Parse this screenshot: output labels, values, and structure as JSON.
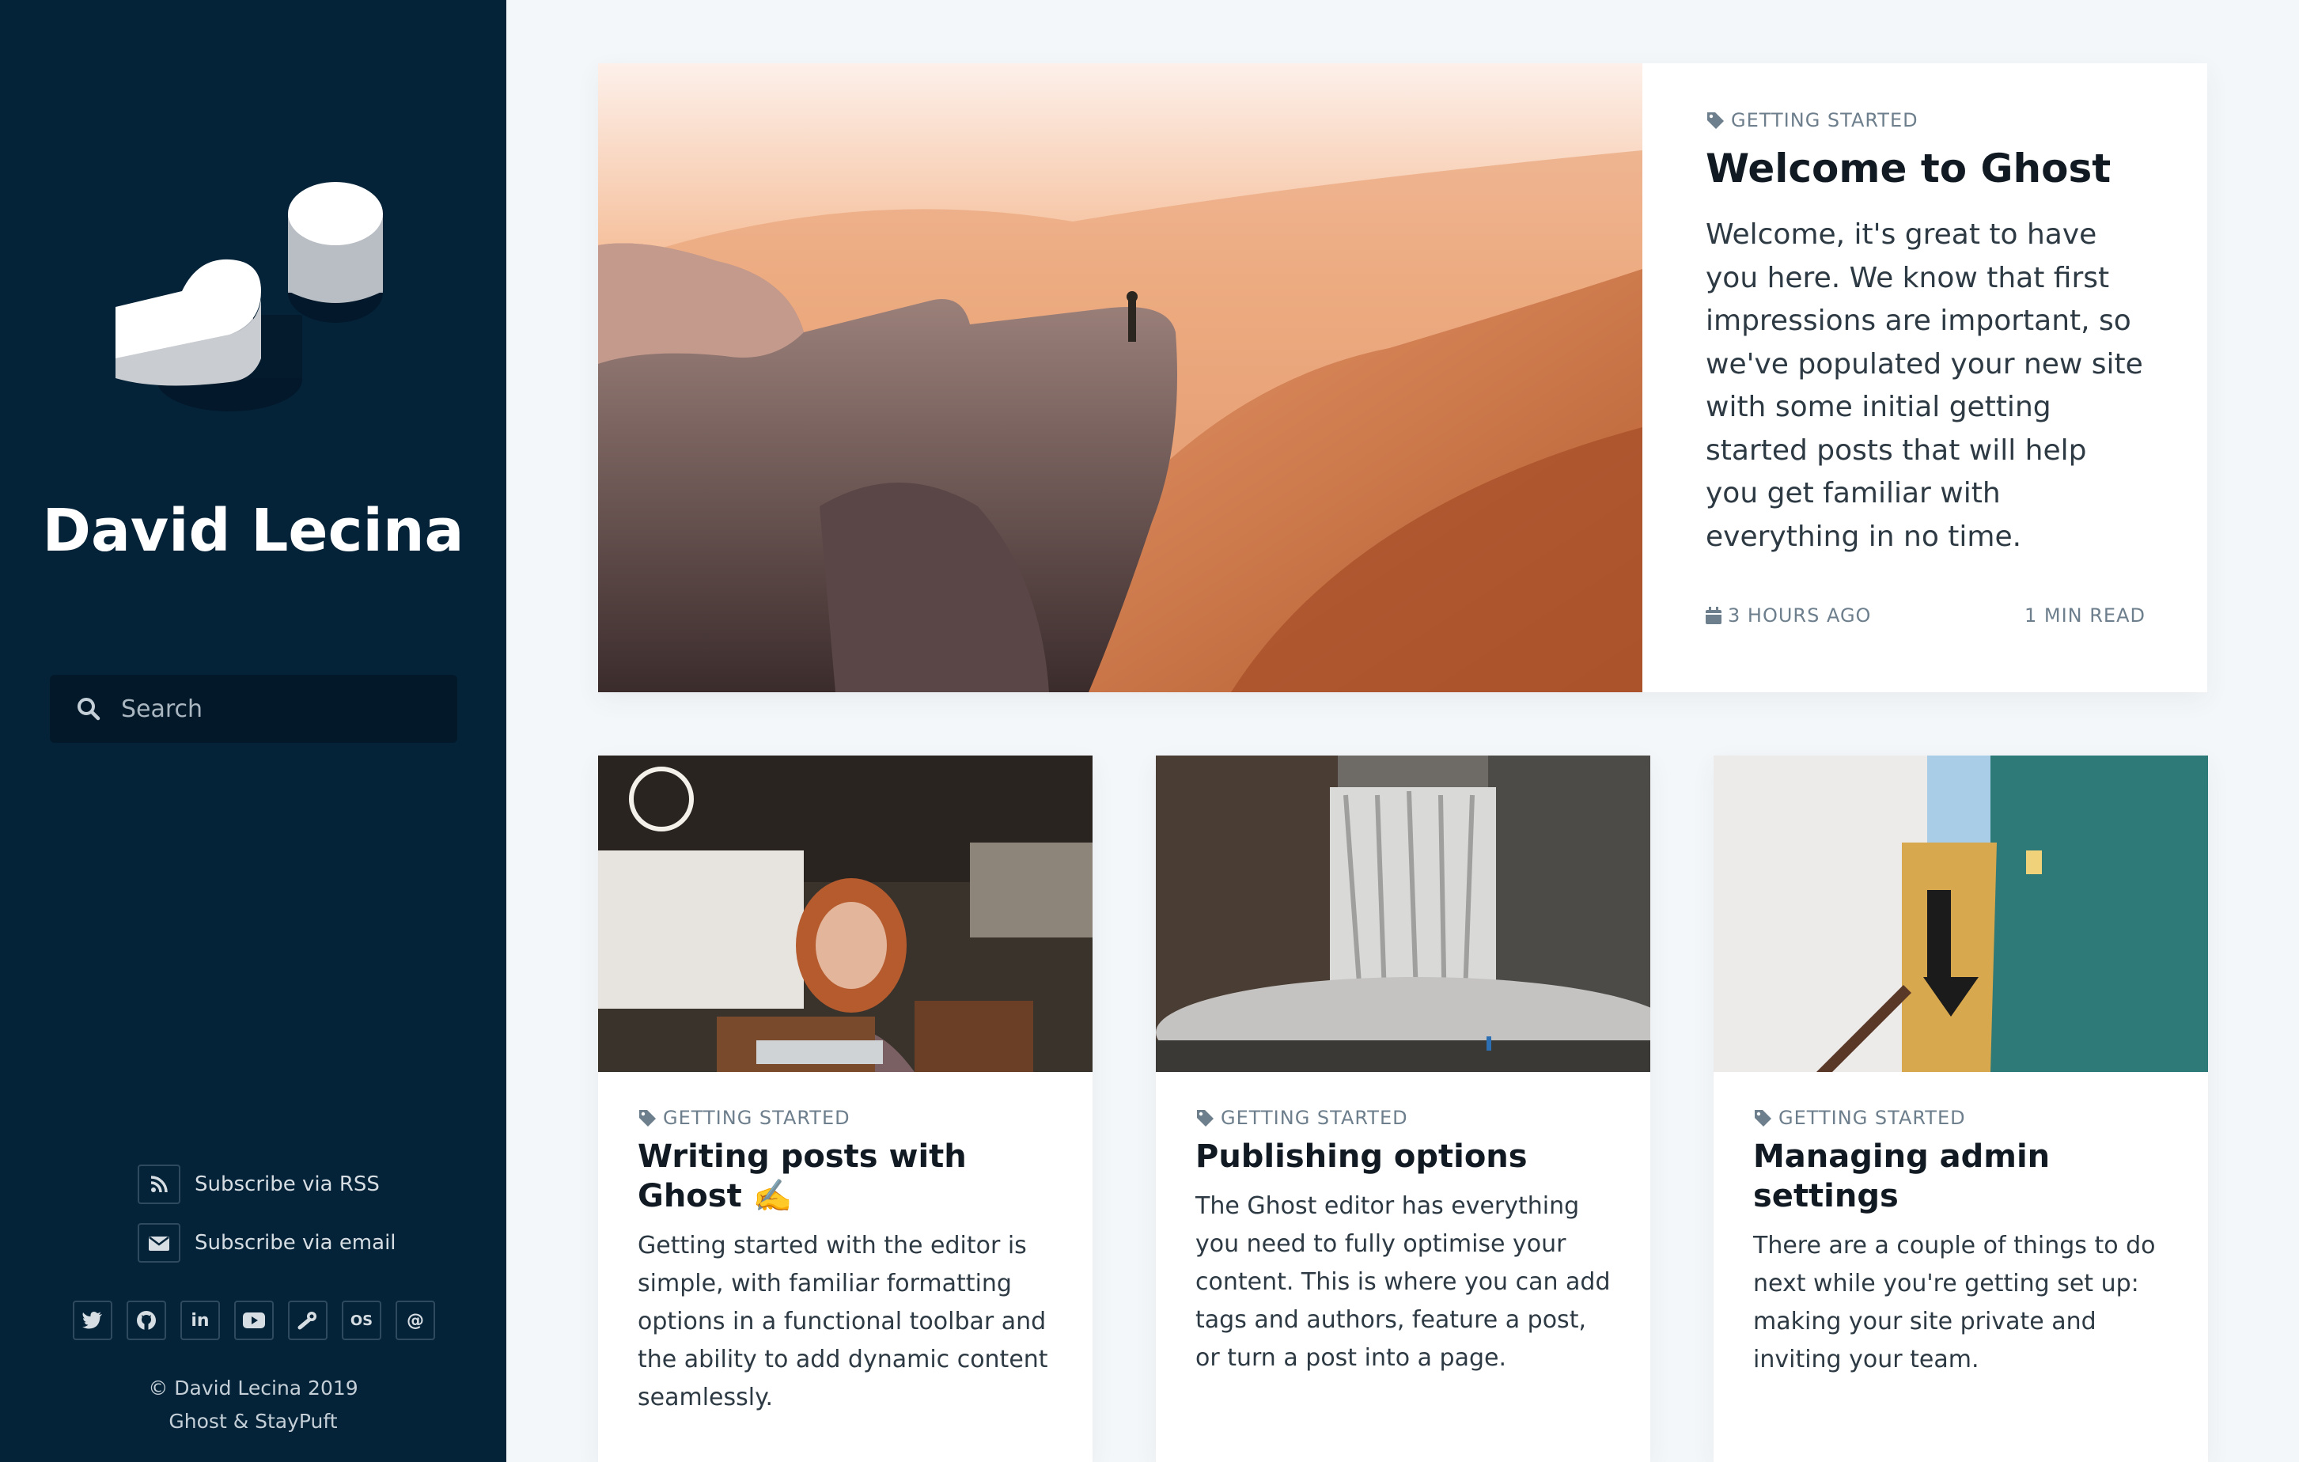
{
  "sidebar": {
    "site_title": "David Lecina",
    "search_placeholder": "Search",
    "subscribe_rss": "Subscribe via RSS",
    "subscribe_email": "Subscribe via email",
    "social": [
      {
        "name": "twitter-icon"
      },
      {
        "name": "github-icon"
      },
      {
        "name": "linkedin-icon"
      },
      {
        "name": "youtube-icon"
      },
      {
        "name": "steam-icon"
      },
      {
        "name": "lastfm-icon"
      },
      {
        "name": "at-icon"
      }
    ],
    "social_labels": {
      "linkedin": "in",
      "lastfm": "OS",
      "at": "@"
    },
    "footer_copy": "© David Lecina 2019",
    "footer_credit": "Ghost & StayPuft"
  },
  "featured": {
    "tag": "GETTING STARTED",
    "title": "Welcome to Ghost",
    "excerpt": "Welcome, it's great to have you here. We know that first impressions are important, so we've populated your new site with some initial getting started posts that will help you get familiar with everything in no time.",
    "date": "3 HOURS AGO",
    "read_time": "1 MIN READ"
  },
  "cards": [
    {
      "tag": "GETTING STARTED",
      "title": "Writing posts with Ghost ✍️",
      "excerpt": "Getting started with the editor is simple, with familiar formatting options in a functional toolbar and the ability to add dynamic content seamlessly."
    },
    {
      "tag": "GETTING STARTED",
      "title": "Publishing options",
      "excerpt": "The Ghost editor has everything you need to fully optimise your content. This is where you can add tags and authors, feature a post, or turn a post into a page."
    },
    {
      "tag": "GETTING STARTED",
      "title": "Managing admin settings",
      "excerpt": "There are a couple of things to do next while you're getting set up: making your site private and inviting your team."
    }
  ],
  "colors": {
    "sidebar_bg": "#052338",
    "page_bg": "#f4f7f9",
    "meta_gray": "#6d7e8c"
  }
}
